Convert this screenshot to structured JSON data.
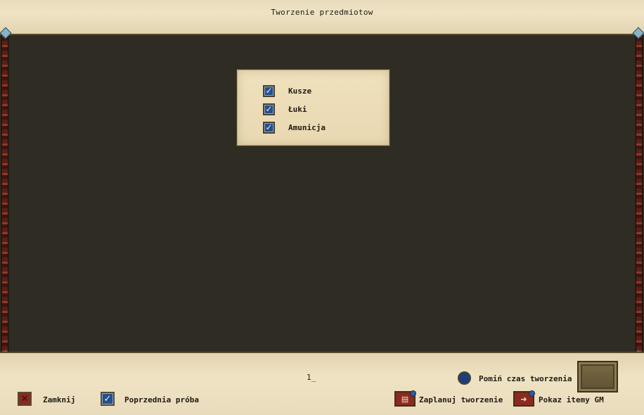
{
  "window": {
    "title": "Tworzenie przedmiotow"
  },
  "filters": [
    {
      "label": "Kusze",
      "checked": true
    },
    {
      "label": "Łuki",
      "checked": true
    },
    {
      "label": "Amunicja",
      "checked": true
    }
  ],
  "bottom": {
    "counter": "1_",
    "skip_time_label": "Pomiń czas tworzenia",
    "close_label": "Zamknij",
    "previous_attempt_label": "Poprzednia próba",
    "schedule_label": "Zaplanuj tworzenie",
    "show_gm_label": "Pokaz itemy GM"
  },
  "icons": {
    "check": "check-icon",
    "close": "close-icon",
    "scroll": "scroll-icon",
    "arrow": "arrow-icon"
  }
}
